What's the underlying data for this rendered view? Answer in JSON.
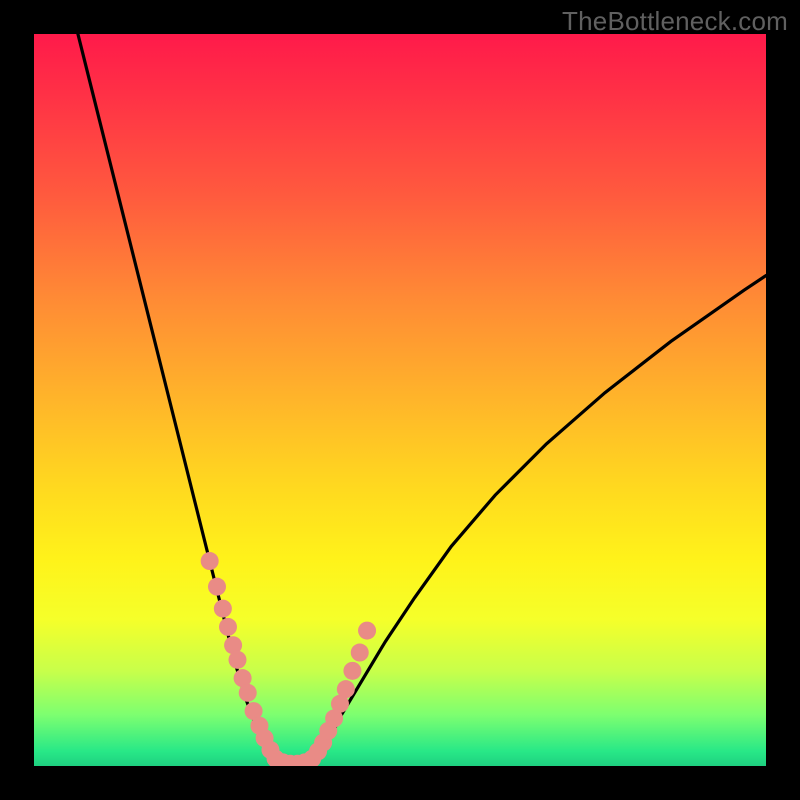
{
  "watermark": "TheBottleneck.com",
  "chart_data": {
    "type": "line",
    "title": "",
    "xlabel": "",
    "ylabel": "",
    "xlim": [
      0,
      100
    ],
    "ylim": [
      0,
      100
    ],
    "series": [
      {
        "name": "left-curve",
        "x": [
          6,
          8,
          10,
          12,
          14,
          16,
          18,
          20,
          22,
          24,
          26,
          27.5,
          29,
          30.5,
          32,
          33
        ],
        "y": [
          100,
          92,
          84,
          76,
          68,
          60,
          52,
          44,
          36,
          28,
          20,
          14,
          9,
          5,
          2,
          0
        ]
      },
      {
        "name": "bottom-flat",
        "x": [
          33,
          34,
          35,
          36,
          37,
          38
        ],
        "y": [
          0,
          0,
          0,
          0,
          0,
          0
        ]
      },
      {
        "name": "right-curve",
        "x": [
          38,
          40,
          42,
          45,
          48,
          52,
          57,
          63,
          70,
          78,
          87,
          97,
          100
        ],
        "y": [
          0,
          3,
          7,
          12,
          17,
          23,
          30,
          37,
          44,
          51,
          58,
          65,
          67
        ]
      }
    ],
    "marker_points": {
      "comment": "salmon circles clustered near the V bottom",
      "x": [
        24.0,
        25.0,
        25.8,
        26.5,
        27.2,
        27.8,
        28.5,
        29.2,
        30.0,
        30.8,
        31.5,
        32.3,
        33.0,
        34.0,
        35.0,
        36.0,
        37.0,
        38.0,
        38.8,
        39.5,
        40.2,
        41.0,
        41.8,
        42.6,
        43.5,
        44.5,
        45.5
      ],
      "y": [
        28.0,
        24.5,
        21.5,
        19.0,
        16.5,
        14.5,
        12.0,
        10.0,
        7.5,
        5.5,
        3.8,
        2.2,
        1.0,
        0.5,
        0.3,
        0.3,
        0.5,
        1.0,
        2.0,
        3.2,
        4.8,
        6.5,
        8.5,
        10.5,
        13.0,
        15.5,
        18.5
      ]
    },
    "colors": {
      "curve": "#000000",
      "markers": "#e98b86",
      "background_top": "#ff1a4a",
      "background_bottom": "#1ed080"
    }
  }
}
